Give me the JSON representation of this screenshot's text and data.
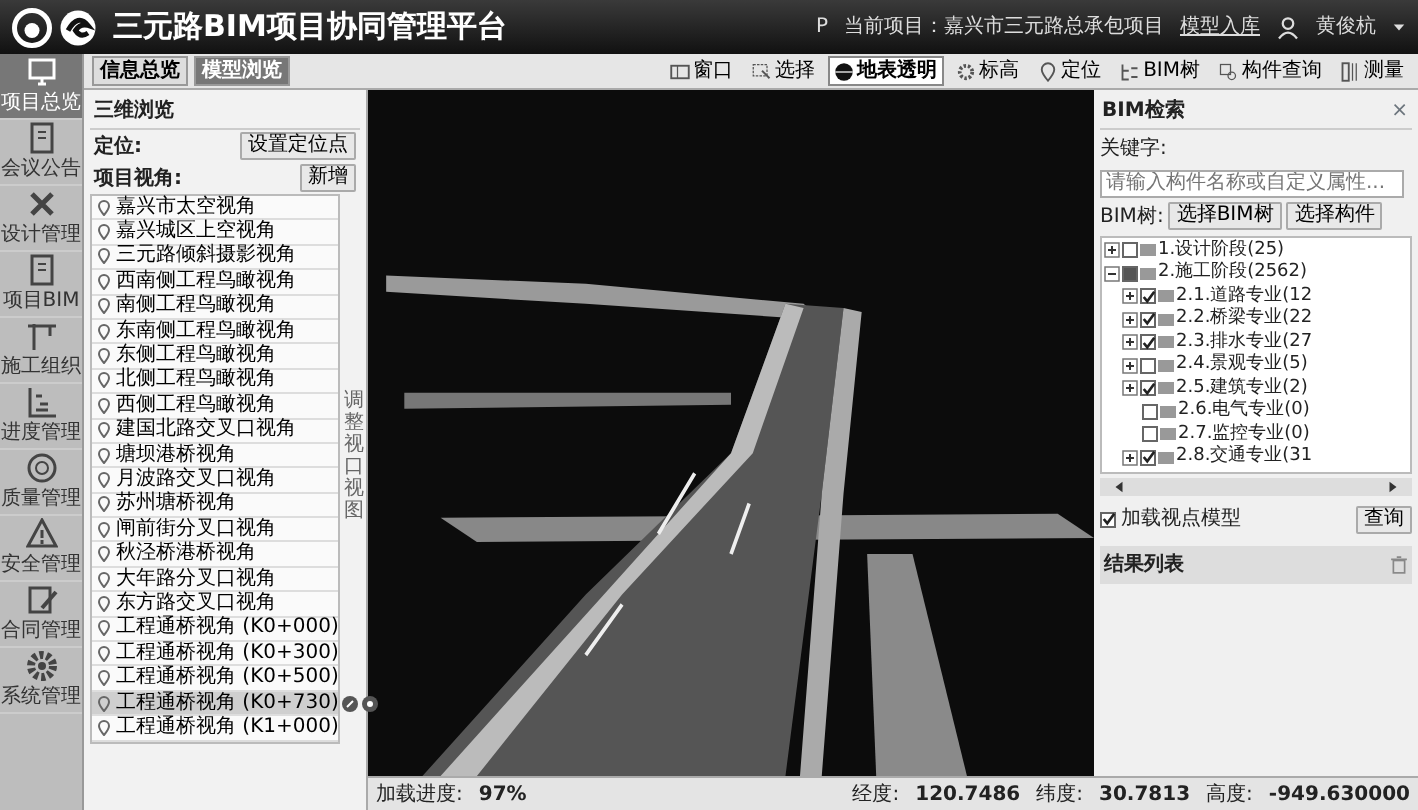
{
  "header": {
    "title": "三元路BIM项目协同管理平台",
    "project_icon": "P",
    "project": "当前项目：嘉兴市三元路总承包项目",
    "import_link": "模型入库",
    "user": "黄俊杭"
  },
  "sidebar": {
    "items": [
      {
        "label": "项目总览",
        "selected": true
      },
      {
        "label": "会议公告",
        "selected": false
      },
      {
        "label": "设计管理",
        "selected": false
      },
      {
        "label": "项目BIM",
        "selected": false
      },
      {
        "label": "施工组织",
        "selected": false
      },
      {
        "label": "进度管理",
        "selected": false
      },
      {
        "label": "质量管理",
        "selected": false
      },
      {
        "label": "安全管理",
        "selected": false
      },
      {
        "label": "合同管理",
        "selected": false
      },
      {
        "label": "系统管理",
        "selected": false
      }
    ]
  },
  "tabs": [
    {
      "label": "信息总览",
      "selected": false
    },
    {
      "label": "模型浏览",
      "selected": true
    }
  ],
  "tools": [
    {
      "label": "窗口",
      "active": false
    },
    {
      "label": "选择",
      "active": false
    },
    {
      "label": "地表透明",
      "active": true
    },
    {
      "label": "标高",
      "active": false
    },
    {
      "label": "定位",
      "active": false
    },
    {
      "label": "BIM树",
      "active": false
    },
    {
      "label": "构件查询",
      "active": false
    },
    {
      "label": "测量",
      "active": false
    }
  ],
  "left_panel": {
    "title": "三维浏览",
    "locate_label": "定位:",
    "locate_button": "设置定位点",
    "viewpoints_label": "项目视角:",
    "add_button": "新增",
    "side_handle": "调整视口视图",
    "viewpoints": [
      {
        "label": "嘉兴市太空视角",
        "selected": false
      },
      {
        "label": "嘉兴城区上空视角",
        "selected": false
      },
      {
        "label": "三元路倾斜摄影视角",
        "selected": false
      },
      {
        "label": "西南侧工程鸟瞰视角",
        "selected": false
      },
      {
        "label": "南侧工程鸟瞰视角",
        "selected": false
      },
      {
        "label": "东南侧工程鸟瞰视角",
        "selected": false
      },
      {
        "label": "东侧工程鸟瞰视角",
        "selected": false
      },
      {
        "label": "北侧工程鸟瞰视角",
        "selected": false
      },
      {
        "label": "西侧工程鸟瞰视角",
        "selected": false
      },
      {
        "label": "建国北路交叉口视角",
        "selected": false
      },
      {
        "label": "塘坝港桥视角",
        "selected": false
      },
      {
        "label": "月波路交叉口视角",
        "selected": false
      },
      {
        "label": "苏州塘桥视角",
        "selected": false
      },
      {
        "label": "闸前街分叉口视角",
        "selected": false
      },
      {
        "label": "秋泾桥港桥视角",
        "selected": false
      },
      {
        "label": "大年路分叉口视角",
        "selected": false
      },
      {
        "label": "东方路交叉口视角",
        "selected": false
      },
      {
        "label": "工程通桥视角 (K0+000)",
        "selected": false
      },
      {
        "label": "工程通桥视角 (K0+300)",
        "selected": false
      },
      {
        "label": "工程通桥视角 (K0+500)",
        "selected": false
      },
      {
        "label": "工程通桥视角 (K0+730)",
        "selected": true
      },
      {
        "label": "工程通桥视角 (K1+000)",
        "selected": false
      }
    ]
  },
  "right_panel": {
    "title": "BIM检索",
    "close": "×",
    "keyword_label": "关键字:",
    "keyword_placeholder": "请输入构件名称或自定义属性...",
    "tree_label": "BIM树:",
    "tree_buttons": [
      "选择BIM树",
      "选择构件"
    ],
    "tree": [
      {
        "label": "1.设计阶段(25)",
        "kind": "group",
        "expanded": false,
        "checked": false,
        "partial": false
      },
      {
        "label": "2.施工阶段(2562)",
        "kind": "group",
        "expanded": true,
        "checked": false,
        "partial": true,
        "children": [
          {
            "label": "2.1.道路专业(12",
            "kind": "group",
            "expanded": false,
            "checked": true
          },
          {
            "label": "2.2.桥梁专业(22",
            "kind": "group",
            "expanded": false,
            "checked": true
          },
          {
            "label": "2.3.排水专业(27",
            "kind": "group",
            "expanded": false,
            "checked": true
          },
          {
            "label": "2.4.景观专业(5)",
            "kind": "group",
            "expanded": false,
            "checked": false
          },
          {
            "label": "2.5.建筑专业(2)",
            "kind": "group",
            "expanded": false,
            "checked": true
          },
          {
            "label": "2.6.电气专业(0)",
            "kind": "leaf",
            "checked": false
          },
          {
            "label": "2.7.监控专业(0)",
            "kind": "leaf",
            "checked": false
          },
          {
            "label": "2.8.交通专业(31",
            "kind": "group",
            "expanded": false,
            "checked": true
          }
        ]
      }
    ],
    "load_viewpoint": {
      "label": "加载视点模型",
      "checked": true
    },
    "query_button": "查询",
    "results_title": "结果列表"
  },
  "status_bar": {
    "progress_label": "加载进度:",
    "progress": "97%",
    "lon_label": "经度:",
    "lon": "120.7486",
    "lat_label": "纬度:",
    "lat": "30.7813",
    "alt_label": "高度:",
    "alt": "-949.630000"
  }
}
